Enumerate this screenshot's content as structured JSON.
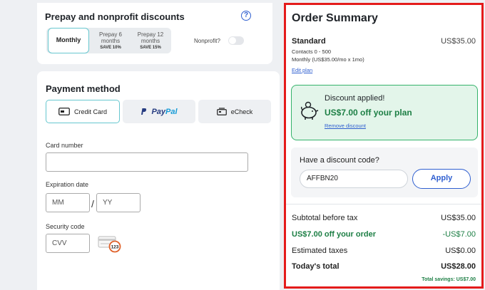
{
  "prepay": {
    "title": "Prepay and nonprofit discounts",
    "options": [
      {
        "label": "Monthly",
        "sub": ""
      },
      {
        "label": "Prepay 6 months",
        "line1": "Prepay 6",
        "line2": "months",
        "sub": "SAVE 10%"
      },
      {
        "label": "Prepay 12 months",
        "line1": "Prepay 12",
        "line2": "months",
        "sub": "SAVE 15%"
      }
    ],
    "selected": "Monthly",
    "nonprofit_label": "Nonprofit?"
  },
  "payment": {
    "title": "Payment method",
    "methods": [
      "Credit Card",
      "PayPal",
      "eCheck"
    ],
    "paypal_part1": "Pay",
    "paypal_part2": "Pal",
    "selected": "Credit Card",
    "card_number_label": "Card number",
    "card_number_value": "",
    "expiration_label": "Expiration date",
    "month_placeholder": "MM",
    "year_placeholder": "YY",
    "separator": "/",
    "security_label": "Security code",
    "cvv_placeholder": "CVV",
    "cvv_icon_text": "123"
  },
  "summary": {
    "title": "Order Summary",
    "plan_name": "Standard",
    "plan_price": "US$35.00",
    "contacts": "Contacts 0 - 500",
    "billing": "Monthly (US$35.00/mo x 1mo)",
    "edit_plan": "Edit plan",
    "discount_title": "Discount applied!",
    "discount_amount": "US$7.00 off your plan",
    "remove_discount": "Remove discount",
    "code_label": "Have a discount code?",
    "code_value": "AFFBN20",
    "apply_label": "Apply",
    "subtotal_label": "Subtotal before tax",
    "subtotal_value": "US$35.00",
    "discount_line_label": "US$7.00 off your order",
    "discount_line_value": "-US$7.00",
    "taxes_label": "Estimated taxes",
    "taxes_value": "US$0.00",
    "total_label": "Today's total",
    "total_value": "US$28.00",
    "total_savings": "Total savings: US$7.00"
  },
  "colors": {
    "accent": "#2f5fd0",
    "success": "#1d7f45",
    "highlight_border": "#e41b1b",
    "selected_border": "#67c7cf"
  }
}
